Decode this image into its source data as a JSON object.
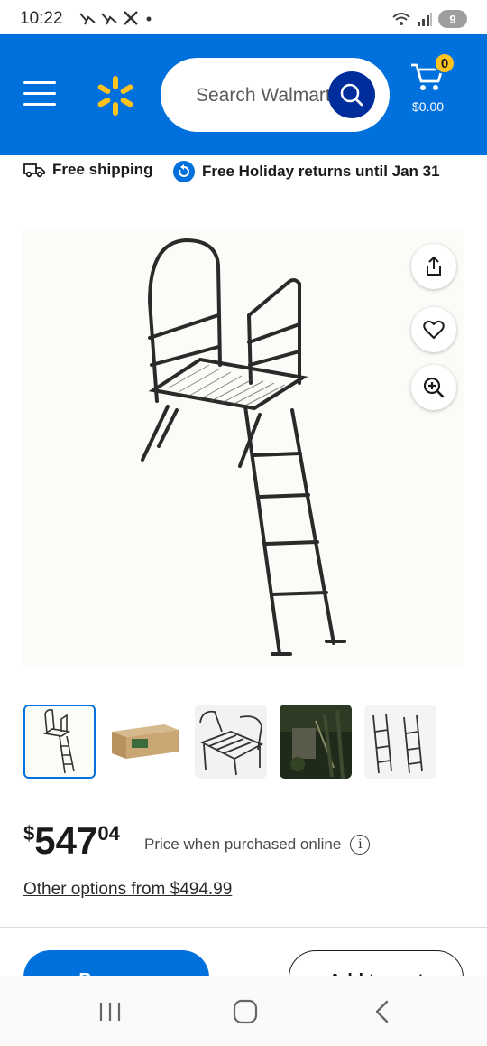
{
  "status_bar": {
    "time": "10:22",
    "battery": "9",
    "left_icons": [
      "notification-bird-icon",
      "notification-bird-icon",
      "x-logo-icon",
      "dot-icon"
    ],
    "right_icons": [
      "wifi-icon",
      "signal-icon",
      "battery-icon"
    ]
  },
  "header": {
    "search_placeholder": "Search Walmart",
    "cart_count": "0",
    "cart_total": "$0.00",
    "brand_color": "#0071dc",
    "spark_color": "#ffc220"
  },
  "shipping_bar": {
    "free_shipping": "Free shipping",
    "holiday_returns": "Free Holiday returns until Jan 31"
  },
  "product": {
    "actions": [
      "share-icon",
      "heart-icon",
      "zoom-in-icon"
    ],
    "thumbnails": [
      "ladder-stand-front",
      "product-box",
      "platform-closeup",
      "stand-in-woods",
      "ladder-sections"
    ],
    "price_dollar_sign": "$",
    "price_main": "547",
    "price_cents": "04",
    "price_note": "Price when purchased online",
    "other_options": "Other options from $494.99"
  },
  "actions": {
    "buy_now": "Buy now",
    "add_to_cart": "Add to cart"
  },
  "nav": {
    "icons": [
      "recent-apps-icon",
      "home-icon",
      "back-icon"
    ]
  }
}
